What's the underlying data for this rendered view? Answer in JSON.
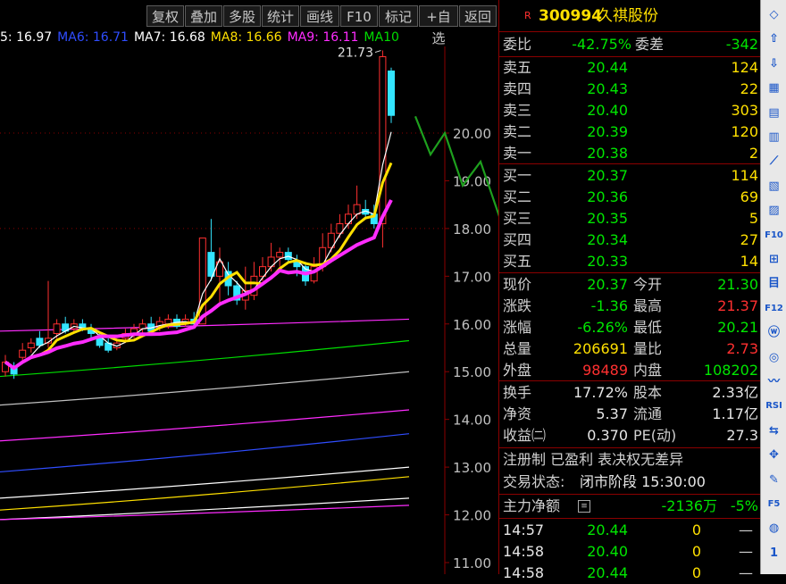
{
  "toolbar": {
    "buttons": [
      "复权",
      "叠加",
      "多股",
      "统计",
      "画线",
      "F10",
      "标记",
      "+自选",
      "返回"
    ]
  },
  "ma_legend": [
    {
      "label": "5: 16.97",
      "color": "#ffffff"
    },
    {
      "label": "MA6: 16.71",
      "color": "#2f4dff"
    },
    {
      "label": "MA7: 16.68",
      "color": "#ffffff"
    },
    {
      "label": "MA8: 16.66",
      "color": "#ffe000"
    },
    {
      "label": "MA9: 16.11",
      "color": "#ff2cff"
    },
    {
      "label": "MA10",
      "color": "#00dd00"
    }
  ],
  "chart": {
    "price_axis": [
      "20.00",
      "19.00",
      "18.00",
      "17.00",
      "16.00",
      "15.00",
      "14.00",
      "13.00",
      "12.00",
      "11.00"
    ],
    "high_label": "21.73",
    "ylim": [
      11.0,
      20.0
    ],
    "candles": [
      {
        "o": 15.0,
        "c": 15.2,
        "h": 15.35,
        "l": 14.9
      },
      {
        "o": 15.1,
        "c": 14.95,
        "h": 15.2,
        "l": 14.85
      },
      {
        "o": 15.3,
        "c": 15.45,
        "h": 15.6,
        "l": 15.2
      },
      {
        "o": 15.5,
        "c": 15.6,
        "h": 15.7,
        "l": 15.4
      },
      {
        "o": 15.7,
        "c": 15.55,
        "h": 15.85,
        "l": 15.5
      },
      {
        "o": 15.6,
        "c": 15.7,
        "h": 16.9,
        "l": 15.5
      },
      {
        "o": 15.8,
        "c": 16.0,
        "h": 16.1,
        "l": 15.7
      },
      {
        "o": 16.0,
        "c": 15.85,
        "h": 16.15,
        "l": 15.8
      },
      {
        "o": 15.9,
        "c": 16.0,
        "h": 16.1,
        "l": 15.8
      },
      {
        "o": 16.0,
        "c": 15.9,
        "h": 16.1,
        "l": 15.85
      },
      {
        "o": 15.9,
        "c": 15.8,
        "h": 16.0,
        "l": 15.7
      },
      {
        "o": 15.7,
        "c": 15.55,
        "h": 15.8,
        "l": 15.5
      },
      {
        "o": 15.6,
        "c": 15.45,
        "h": 15.7,
        "l": 15.4
      },
      {
        "o": 15.5,
        "c": 15.6,
        "h": 15.7,
        "l": 15.45
      },
      {
        "o": 15.7,
        "c": 15.8,
        "h": 15.9,
        "l": 15.6
      },
      {
        "o": 15.8,
        "c": 15.9,
        "h": 16.0,
        "l": 15.7
      },
      {
        "o": 15.9,
        "c": 16.0,
        "h": 16.1,
        "l": 15.8
      },
      {
        "o": 16.0,
        "c": 15.85,
        "h": 16.15,
        "l": 15.8
      },
      {
        "o": 15.95,
        "c": 16.05,
        "h": 16.15,
        "l": 15.85
      },
      {
        "o": 16.0,
        "c": 16.1,
        "h": 16.2,
        "l": 15.9
      },
      {
        "o": 16.1,
        "c": 15.95,
        "h": 16.2,
        "l": 15.9
      },
      {
        "o": 16.0,
        "c": 16.1,
        "h": 16.2,
        "l": 15.95
      },
      {
        "o": 16.1,
        "c": 16.0,
        "h": 16.25,
        "l": 15.95
      },
      {
        "o": 16.0,
        "c": 17.8,
        "h": 17.8,
        "l": 16.0
      },
      {
        "o": 17.5,
        "c": 17.0,
        "h": 18.2,
        "l": 16.9
      },
      {
        "o": 17.0,
        "c": 17.3,
        "h": 17.6,
        "l": 16.4
      },
      {
        "o": 17.1,
        "c": 16.8,
        "h": 17.3,
        "l": 16.6
      },
      {
        "o": 16.8,
        "c": 16.5,
        "h": 16.9,
        "l": 16.4
      },
      {
        "o": 16.5,
        "c": 16.7,
        "h": 17.2,
        "l": 16.3
      },
      {
        "o": 16.6,
        "c": 17.0,
        "h": 17.3,
        "l": 16.5
      },
      {
        "o": 17.0,
        "c": 17.2,
        "h": 17.4,
        "l": 16.9
      },
      {
        "o": 17.2,
        "c": 17.4,
        "h": 17.7,
        "l": 17.1
      },
      {
        "o": 17.4,
        "c": 17.5,
        "h": 17.6,
        "l": 17.2
      },
      {
        "o": 17.5,
        "c": 17.35,
        "h": 17.6,
        "l": 17.3
      },
      {
        "o": 17.3,
        "c": 17.2,
        "h": 17.45,
        "l": 17.0
      },
      {
        "o": 17.2,
        "c": 16.9,
        "h": 17.3,
        "l": 16.8
      },
      {
        "o": 16.9,
        "c": 17.2,
        "h": 17.4,
        "l": 16.85
      },
      {
        "o": 17.2,
        "c": 17.6,
        "h": 17.9,
        "l": 17.1
      },
      {
        "o": 17.6,
        "c": 17.9,
        "h": 18.1,
        "l": 17.5
      },
      {
        "o": 17.9,
        "c": 18.1,
        "h": 18.3,
        "l": 17.8
      },
      {
        "o": 18.1,
        "c": 18.3,
        "h": 18.5,
        "l": 18.0
      },
      {
        "o": 18.3,
        "c": 18.5,
        "h": 18.9,
        "l": 18.2
      },
      {
        "o": 18.4,
        "c": 18.3,
        "h": 18.6,
        "l": 18.2
      },
      {
        "o": 18.3,
        "c": 18.1,
        "h": 18.5,
        "l": 18.0
      },
      {
        "o": 18.1,
        "c": 21.6,
        "h": 21.73,
        "l": 17.6
      },
      {
        "o": 21.3,
        "c": 20.37,
        "h": 21.37,
        "l": 20.21
      }
    ]
  },
  "side": {
    "code": "300994",
    "name": "久祺股份",
    "ratio": {
      "l1": "委比",
      "v1": "-42.75%",
      "l2": "委差",
      "v2": "-342"
    },
    "asks": [
      {
        "label": "卖五",
        "price": "20.44",
        "vol": "124"
      },
      {
        "label": "卖四",
        "price": "20.43",
        "vol": "22"
      },
      {
        "label": "卖三",
        "price": "20.40",
        "vol": "303"
      },
      {
        "label": "卖二",
        "price": "20.39",
        "vol": "120"
      },
      {
        "label": "卖一",
        "price": "20.38",
        "vol": "2"
      }
    ],
    "bids": [
      {
        "label": "买一",
        "price": "20.37",
        "vol": "114"
      },
      {
        "label": "买二",
        "price": "20.36",
        "vol": "69"
      },
      {
        "label": "买三",
        "price": "20.35",
        "vol": "5"
      },
      {
        "label": "买四",
        "price": "20.34",
        "vol": "27"
      },
      {
        "label": "买五",
        "price": "20.33",
        "vol": "14"
      }
    ],
    "quote": [
      {
        "l1": "现价",
        "v1": "20.37",
        "l2": "今开",
        "v2": "21.30"
      },
      {
        "l1": "涨跌",
        "v1": "-1.36",
        "l2": "最高",
        "v2": "21.37"
      },
      {
        "l1": "涨幅",
        "v1": "-6.26%",
        "l2": "最低",
        "v2": "20.21"
      },
      {
        "l1": "总量",
        "v1": "206691",
        "l2": "量比",
        "v2": "2.73"
      },
      {
        "l1": "外盘",
        "v1": "98489",
        "l2": "内盘",
        "v2": "108202"
      }
    ],
    "finance": [
      {
        "l1": "换手",
        "v1": "17.72%",
        "l2": "股本",
        "v2": "2.33亿"
      },
      {
        "l1": "净资",
        "v1": "5.37",
        "l2": "流通",
        "v2": "1.17亿"
      },
      {
        "l1": "收益㈡",
        "v1": "0.370",
        "l2": "PE(动)",
        "v2": "27.3"
      }
    ],
    "info1": "注册制 已盈利 表决权无差异",
    "status_label": "交易状态:",
    "status_value": "闭市阶段 15:30:00",
    "flow": {
      "label": "主力净额",
      "value": "-2136万",
      "pct": "-5%"
    },
    "ticks": [
      {
        "time": "14:57",
        "price": "20.44",
        "vol": "0",
        "dir": "—"
      },
      {
        "time": "14:58",
        "price": "20.40",
        "vol": "0",
        "dir": "—"
      },
      {
        "time": "14:58",
        "price": "20.44",
        "vol": "0",
        "dir": "—"
      }
    ]
  },
  "tools": [
    "◇",
    "⇧",
    "⇩",
    "▦",
    "▤",
    "▥",
    "⟋",
    "▧",
    "▨",
    "F10",
    "⊞",
    "目",
    "F12",
    "ⓦ",
    "◎",
    "〰",
    "RSI",
    "⇆",
    "✥",
    "✎",
    "F5",
    "◍",
    "1"
  ]
}
